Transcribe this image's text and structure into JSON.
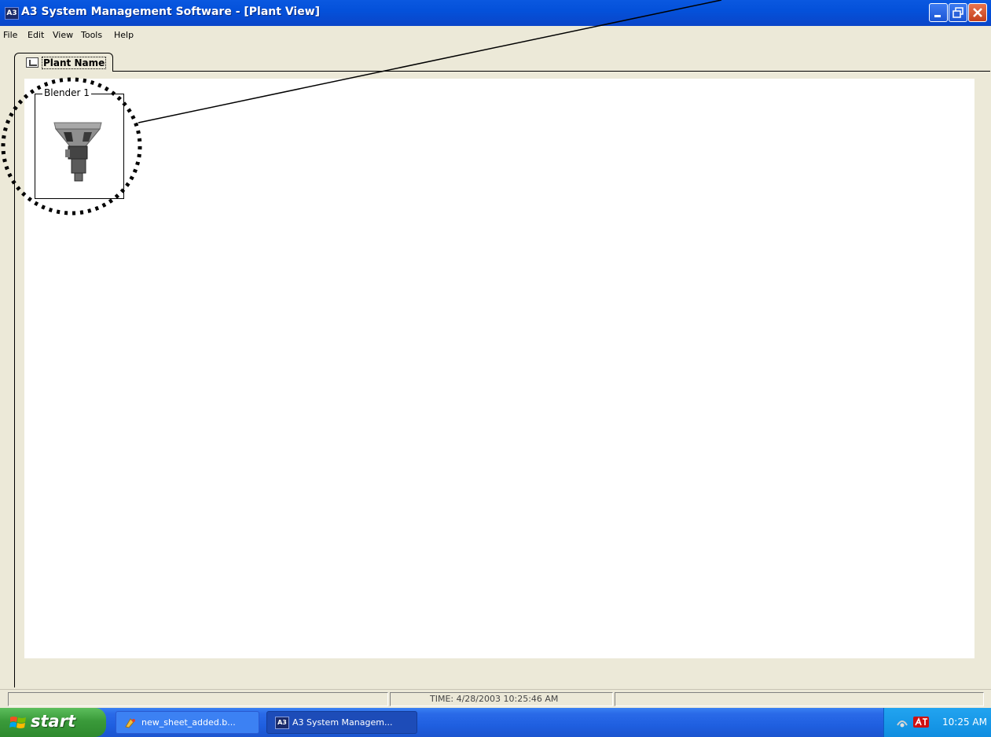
{
  "window": {
    "app_icon_label": "A3",
    "title": "A3 System Management Software - [Plant View]",
    "controls": [
      "minimize-icon",
      "restore-icon",
      "close-icon"
    ]
  },
  "menu": {
    "file": "File",
    "edit": "Edit",
    "view": "View",
    "tools": "Tools",
    "help": "Help"
  },
  "tab": {
    "label": "Plant Name",
    "icon": "plant-view-icon"
  },
  "sheet": {
    "blender": {
      "label": "Blender 1",
      "icon": "blender-machine-icon"
    }
  },
  "statusbar": {
    "time_text": "TIME:  4/28/2003 10:25:46 AM"
  },
  "taskbar": {
    "start_label": "start",
    "buttons": [
      {
        "label": "new_sheet_added.b...",
        "icon": "paint-icon"
      },
      {
        "label": "A3 System Managem...",
        "icon": "a3-app-icon",
        "icon_text": "A3"
      }
    ],
    "clock": "10:25 AM"
  },
  "colors": {
    "titlebar": "#0451da",
    "window_bg": "#ece9d8",
    "sheet_bg": "#ffffff",
    "taskbar": "#2a6ae8",
    "start_button": "#3a9a3a",
    "tray": "#0f8de0"
  }
}
